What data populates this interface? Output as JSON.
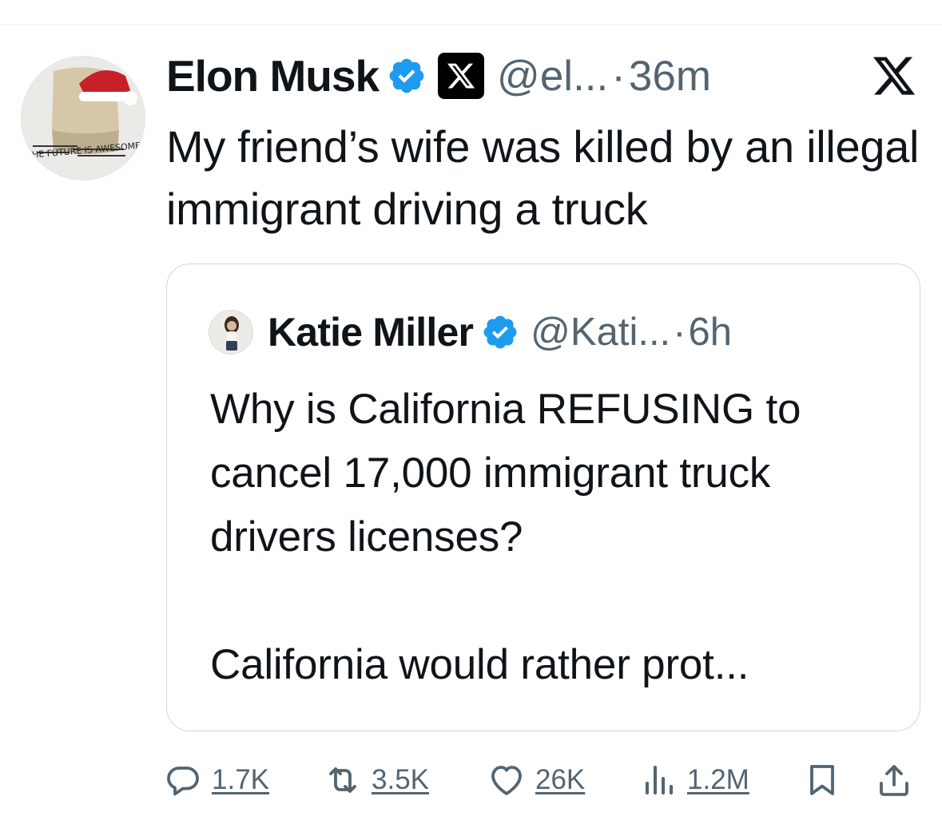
{
  "tweet": {
    "author_name": "Elon Musk",
    "author_handle": "@el...",
    "time": "36m",
    "separator": "·",
    "text": "My friend’s wife was killed by an illegal immigrant driving a truck",
    "avatar_text": "THE FUTURE IS AWESOME"
  },
  "quoted": {
    "author_name": "Katie Miller",
    "author_handle": "@Kati...",
    "time": "6h",
    "separator": "·",
    "text": "Why is California REFUSING to cancel 17,000 immigrant truck drivers licenses?\n\nCalifornia would rather prot..."
  },
  "actions": {
    "replies": "1.7K",
    "reposts": "3.5K",
    "likes": "26K",
    "views": "1.2M"
  },
  "icons": {
    "verified": "verified-badge-icon",
    "affiliate": "x-logo-icon",
    "close": "x-close-icon",
    "reply": "reply-icon",
    "repost": "repost-icon",
    "like": "heart-icon",
    "views": "views-icon",
    "bookmark": "bookmark-icon",
    "share": "share-icon"
  },
  "colors": {
    "verified_blue": "#1d9bf0",
    "secondary_text": "#536471",
    "border": "#cfd9de"
  }
}
